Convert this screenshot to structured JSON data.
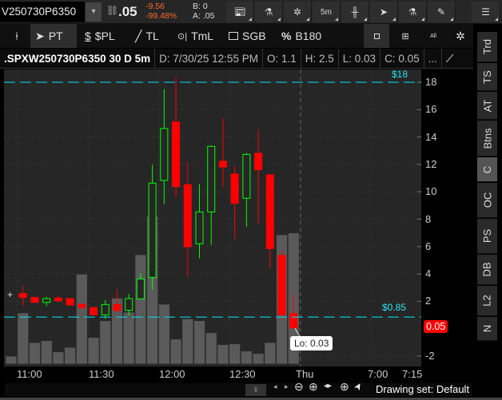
{
  "toolbar": {
    "symbol": ".SPXW250730P6350",
    "symbol_shown": "V250730P6350",
    "last": ".05",
    "change": "-9.56",
    "change_pct": "-99.48%",
    "bid": "B: 0",
    "ask": "A: .05",
    "timeframe": "5m",
    "icons": [
      "news-icon",
      "flask-icon",
      "gear-icon",
      "timeframe",
      "candle-style-icon",
      "cursor-icon",
      "flask-icon",
      "drawing-icon",
      "menu-icon"
    ]
  },
  "drawing_tools": [
    {
      "icon": "pin-icon",
      "label": ""
    },
    {
      "icon": "cursor-icon",
      "label": "PT"
    },
    {
      "icon": "dollar-icon",
      "label": "$PL"
    },
    {
      "icon": "line-icon",
      "label": "TL"
    },
    {
      "icon": "timer-icon",
      "label": "TmL"
    },
    {
      "icon": "square-icon",
      "label": "SGB"
    },
    {
      "icon": "percent-icon",
      "label": "B180"
    }
  ],
  "percent_symbol": "%",
  "dollar_symbol": "$",
  "layout_buttons": {
    "all": "All"
  },
  "info": {
    "title": ".SPXW250730P6350 30 D 5m",
    "date": "D: 7/30/25 12:55 PM",
    "open": "O: 1.1",
    "high": "H: 2.5",
    "low": "L: 0.03",
    "close": "C: 0.05",
    "more": "..."
  },
  "side_tabs": [
    "Trd",
    "TS",
    "AT",
    "Btns",
    "C",
    "OC",
    "PS",
    "DB",
    "L2",
    "N"
  ],
  "side_selected": "C",
  "chart_data": {
    "type": "candlestick",
    "ylim": [
      -2.8,
      18.8
    ],
    "yticks": [
      "18",
      "16",
      "14",
      "12",
      "10",
      "8",
      "6",
      "4",
      "2",
      "-2"
    ],
    "ytick_values": [
      18,
      16,
      14,
      12,
      10,
      8,
      6,
      4,
      2,
      -2
    ],
    "xticks": [
      "11:00",
      "11:30",
      "12:00",
      "12:30",
      "Thu",
      "7:00",
      "7:15"
    ],
    "candles": [
      [
        2.57,
        3.15,
        1.65,
        2.28
      ],
      [
        2.29,
        2.29,
        1.92,
        1.92
      ],
      [
        1.92,
        2.33,
        1.65,
        2.2
      ],
      [
        2.24,
        2.37,
        1.92,
        2.04
      ],
      [
        2.2,
        2.2,
        1.73,
        1.73
      ],
      [
        1.79,
        1.79,
        1.4,
        1.55
      ],
      [
        1.55,
        1.55,
        1.01,
        1.01
      ],
      [
        1.01,
        2.08,
        0.72,
        1.77
      ],
      [
        1.77,
        2.86,
        1.32,
        1.32
      ],
      [
        1.34,
        2.53,
        0.95,
        2.2
      ],
      [
        2.18,
        4.04,
        2.18,
        3.63
      ],
      [
        3.75,
        11.96,
        2.82,
        10.63
      ],
      [
        10.83,
        17.5,
        9.1,
        14.62
      ],
      [
        15.1,
        18.37,
        9.62,
        10.38
      ],
      [
        10.52,
        12.15,
        3.85,
        5.99
      ],
      [
        6.2,
        10.56,
        5.15,
        8.53
      ],
      [
        8.53,
        13.36,
        6.12,
        13.32
      ],
      [
        12.23,
        15.36,
        10.36,
        11.8
      ],
      [
        11.3,
        11.86,
        6.57,
        9.16
      ],
      [
        9.53,
        12.83,
        7.45,
        12.73
      ],
      [
        12.81,
        14.52,
        7.68,
        11.61
      ],
      [
        11.24,
        11.24,
        4.43,
        5.85
      ],
      [
        5.35,
        5.7,
        0.72,
        1.03
      ],
      [
        1.1,
        2.5,
        0.03,
        0.05
      ]
    ],
    "volume_relative": [
      30,
      192,
      81,
      88,
      46,
      63,
      338,
      100,
      163,
      248,
      195,
      411,
      555,
      225,
      94,
      170,
      163,
      118,
      73,
      76,
      49,
      40,
      81,
      486,
      493
    ],
    "levels": [
      {
        "value": 18,
        "label": "$18"
      },
      {
        "value": 0.85,
        "label": "$0.85"
      }
    ],
    "last_price": "0.05",
    "tooltip": "Lo: 0.03",
    "up_color": "#00ff00",
    "down_color": "#ff0000",
    "level_color": "#00e5ff"
  },
  "footer": {
    "drawing_set": "Drawing set: Default"
  }
}
